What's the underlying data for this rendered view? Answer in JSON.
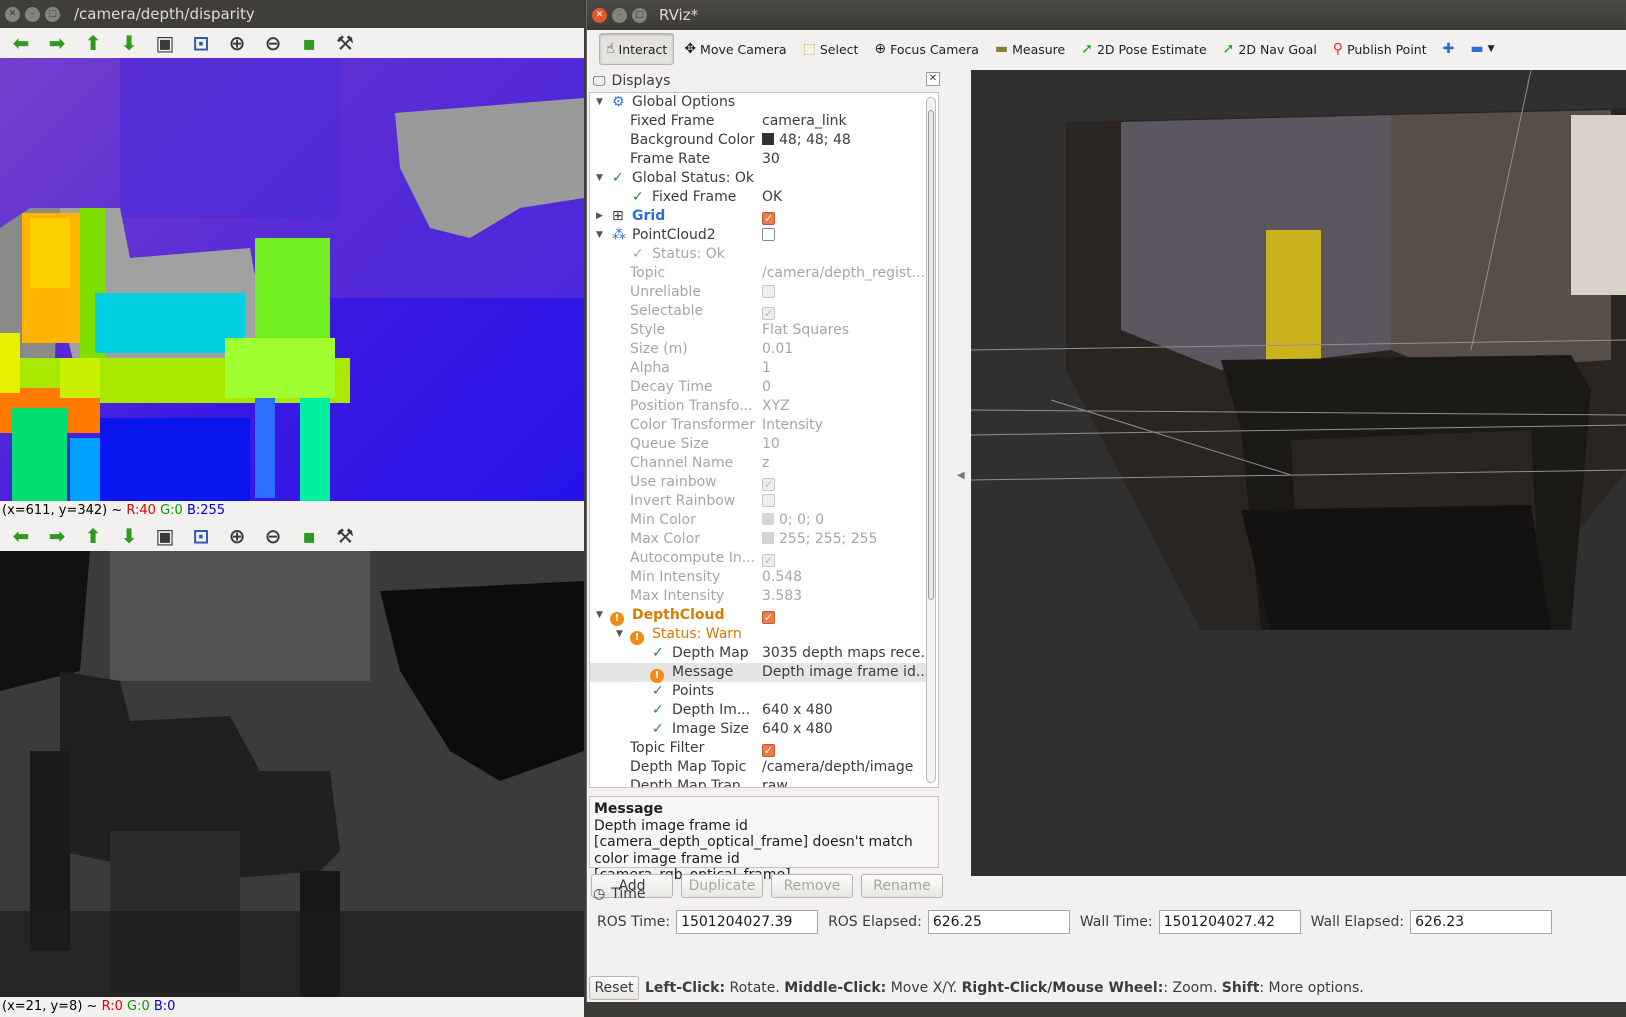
{
  "image_view": {
    "window_title": "/camera/depth/disparity",
    "top_status": {
      "coords": "(x=611, y=342) ~",
      "r": "R:40",
      "g": "G:0",
      "b": "B:255"
    },
    "bottom_status": {
      "coords": "(x=21, y=8) ~",
      "r": "R:0",
      "g": "G:0",
      "b": "B:0"
    }
  },
  "rviz": {
    "window_title": "RViz*",
    "toolbar": [
      {
        "label": "Interact",
        "icon": "cursor-icon"
      },
      {
        "label": "Move Camera",
        "icon": "move-camera-icon"
      },
      {
        "label": "Select",
        "icon": "select-icon"
      },
      {
        "label": "Focus Camera",
        "icon": "focus-camera-icon"
      },
      {
        "label": "Measure",
        "icon": "measure-icon"
      },
      {
        "label": "2D Pose Estimate",
        "icon": "pose-estimate-icon"
      },
      {
        "label": "2D Nav Goal",
        "icon": "nav-goal-icon"
      },
      {
        "label": "Publish Point",
        "icon": "publish-point-icon"
      }
    ],
    "displays_title": "Displays",
    "tree": [
      {
        "key": "Global Options",
        "value": ""
      },
      {
        "key": "Fixed Frame",
        "value": "camera_link"
      },
      {
        "key": "Background Color",
        "value": "48; 48; 48"
      },
      {
        "key": "Frame Rate",
        "value": "30"
      },
      {
        "key": "Global Status: Ok",
        "value": ""
      },
      {
        "key": "Fixed Frame",
        "value": "OK"
      },
      {
        "key": "Grid",
        "value": ""
      },
      {
        "key": "PointCloud2",
        "value": ""
      },
      {
        "key": "Status: Ok",
        "value": ""
      },
      {
        "key": "Topic",
        "value": "/camera/depth_regist..."
      },
      {
        "key": "Unreliable",
        "value": ""
      },
      {
        "key": "Selectable",
        "value": ""
      },
      {
        "key": "Style",
        "value": "Flat Squares"
      },
      {
        "key": "Size (m)",
        "value": "0.01"
      },
      {
        "key": "Alpha",
        "value": "1"
      },
      {
        "key": "Decay Time",
        "value": "0"
      },
      {
        "key": "Position Transfo...",
        "value": "XYZ"
      },
      {
        "key": "Color Transformer",
        "value": "Intensity"
      },
      {
        "key": "Queue Size",
        "value": "10"
      },
      {
        "key": "Channel Name",
        "value": "z"
      },
      {
        "key": "Use rainbow",
        "value": ""
      },
      {
        "key": "Invert Rainbow",
        "value": ""
      },
      {
        "key": "Min Color",
        "value": "0; 0; 0"
      },
      {
        "key": "Max Color",
        "value": "255; 255; 255"
      },
      {
        "key": "Autocompute In...",
        "value": ""
      },
      {
        "key": "Min Intensity",
        "value": "0.548"
      },
      {
        "key": "Max Intensity",
        "value": "3.583"
      },
      {
        "key": "DepthCloud",
        "value": ""
      },
      {
        "key": "Status: Warn",
        "value": ""
      },
      {
        "key": "Depth Map",
        "value": "3035 depth maps rece..."
      },
      {
        "key": "Message",
        "value": "Depth image frame id..."
      },
      {
        "key": "Points",
        "value": ""
      },
      {
        "key": "Depth Im...",
        "value": "640 x 480"
      },
      {
        "key": "Image Size",
        "value": "640 x 480"
      },
      {
        "key": "Topic Filter",
        "value": ""
      },
      {
        "key": "Depth Map Topic",
        "value": "/camera/depth/image"
      },
      {
        "key": "Depth Map Tran...",
        "value": "raw"
      }
    ],
    "message_box": {
      "title": "Message",
      "text": "Depth image frame id [camera_depth_optical_frame] doesn't match color image frame id [camera_rgb_optical_frame]"
    },
    "buttons": {
      "add": "Add",
      "duplicate": "Duplicate",
      "remove": "Remove",
      "rename": "Rename"
    },
    "time": {
      "title": "Time",
      "ros_time_label": "ROS Time:",
      "ros_time": "1501204027.39",
      "ros_elapsed_label": "ROS Elapsed:",
      "ros_elapsed": "626.25",
      "wall_time_label": "Wall Time:",
      "wall_time": "1501204027.42",
      "wall_elapsed_label": "Wall Elapsed:",
      "wall_elapsed": "626.23"
    },
    "bottom": {
      "reset": "Reset",
      "hint_1b": "Left-Click:",
      "hint_1": " Rotate. ",
      "hint_2b": "Middle-Click:",
      "hint_2": " Move X/Y. ",
      "hint_3b": "Right-Click/Mouse Wheel:",
      "hint_3": ": Zoom. ",
      "hint_4b": "Shift",
      "hint_4": ": More options."
    },
    "colors": {
      "background_swatch": "#303030",
      "min_color_swatch": "#000000",
      "max_color_swatch": "#ffffff",
      "warn": "#f08c16",
      "ok": "#2b8a2b",
      "checked": "#ef7a4a"
    }
  }
}
